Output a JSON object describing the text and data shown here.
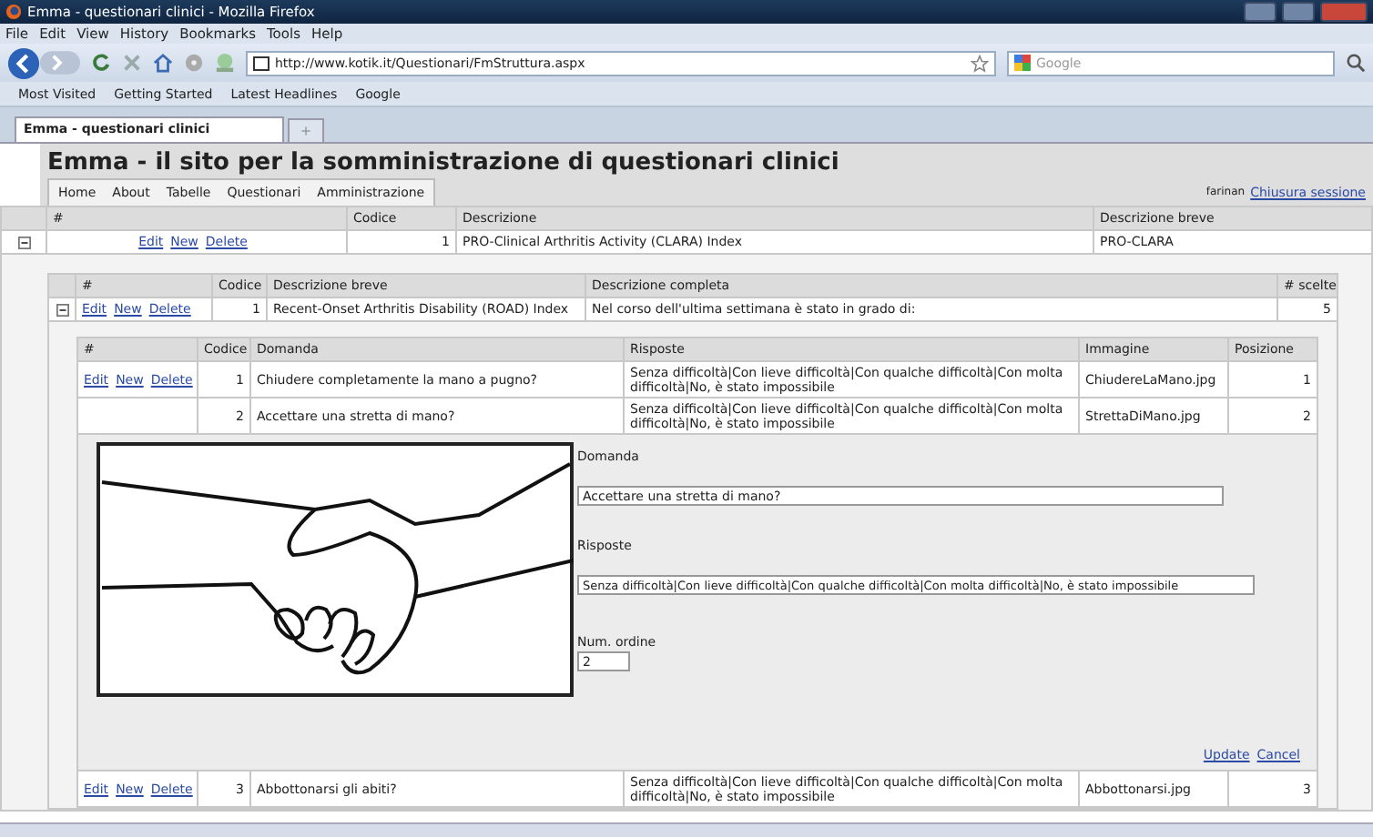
{
  "window": {
    "title": "Emma - questionari clinici - Mozilla Firefox"
  },
  "menu": [
    "File",
    "Edit",
    "View",
    "History",
    "Bookmarks",
    "Tools",
    "Help"
  ],
  "address": {
    "value": "http://www.kotik.it/Questionari/FmStruttura.aspx"
  },
  "search": {
    "placeholder": "Google"
  },
  "bookmarks": [
    "Most Visited",
    "Getting Started",
    "Latest Headlines",
    "Google"
  ],
  "tabs": [
    {
      "label": "Emma - questionari clinici",
      "selected": true
    }
  ],
  "page": {
    "title": "Emma - il sito per la somministrazione di questionari clinici",
    "nav": [
      "Home",
      "About",
      "Tabelle",
      "Questionari",
      "Amministrazione"
    ],
    "user": "farinan",
    "logout": "Chiusura sessione"
  },
  "outer_table": {
    "columns": [
      "#",
      "Codice",
      "Descrizione",
      "Descrizione breve"
    ],
    "rows": [
      {
        "expanded": true,
        "actions": [
          "Edit",
          "New",
          "Delete"
        ],
        "codice": "1",
        "descrizione": "PRO-Clinical Arthritis Activity (CLARA) Index",
        "breve": "PRO-CLARA"
      }
    ]
  },
  "inner_table": {
    "columns": [
      "#",
      "Codice",
      "Descrizione breve",
      "Descrizione completa",
      "# scelte"
    ],
    "rows": [
      {
        "expanded": true,
        "actions": [
          "Edit",
          "New",
          "Delete"
        ],
        "codice": "1",
        "breve": "Recent-Onset Arthritis Disability (ROAD) Index",
        "completa": "Nel corso dell'ultima settimana è stato in grado di:",
        "scelte": "5"
      }
    ]
  },
  "questions_table": {
    "columns": [
      "#",
      "Codice",
      "Domanda",
      "Risposte",
      "Immagine",
      "Posizione"
    ],
    "rows": [
      {
        "kind": "row",
        "actions": [
          "Edit",
          "New",
          "Delete"
        ],
        "codice": "1",
        "domanda": "Chiudere completamente la mano a pugno?",
        "risposte": "Senza difficoltà|Con lieve difficoltà|Con qualche difficoltà|Con molta difficoltà|No, è stato impossibile",
        "immagine": "ChiudereLaMano.jpg",
        "posizione": "1"
      },
      {
        "kind": "row",
        "codice": "2",
        "domanda": "Accettare una stretta di mano?",
        "risposte": "Senza difficoltà|Con lieve difficoltà|Con qualche difficoltà|Con molta difficoltà|No, è stato impossibile",
        "immagine": "StrettaDiMano.jpg",
        "posizione": "2"
      },
      {
        "kind": "edit",
        "domanda_label": "Domanda",
        "domanda_value": "Accettare una stretta di mano?",
        "risposte_label": "Risposte",
        "risposte_value": "Senza difficoltà|Con lieve difficoltà|Con qualche difficoltà|Con molta difficoltà|No, è stato impossibile",
        "ordine_label": "Num. ordine",
        "ordine_value": "2",
        "links": [
          "Update",
          "Cancel"
        ]
      },
      {
        "kind": "row",
        "actions": [
          "Edit",
          "New",
          "Delete"
        ],
        "codice": "3",
        "domanda": "Abbottonarsi gli abiti?",
        "risposte": "Senza difficoltà|Con lieve difficoltà|Con qualche difficoltà|Con molta difficoltà|No, è stato impossibile",
        "immagine": "Abbottonarsi.jpg",
        "posizione": "3"
      }
    ]
  }
}
